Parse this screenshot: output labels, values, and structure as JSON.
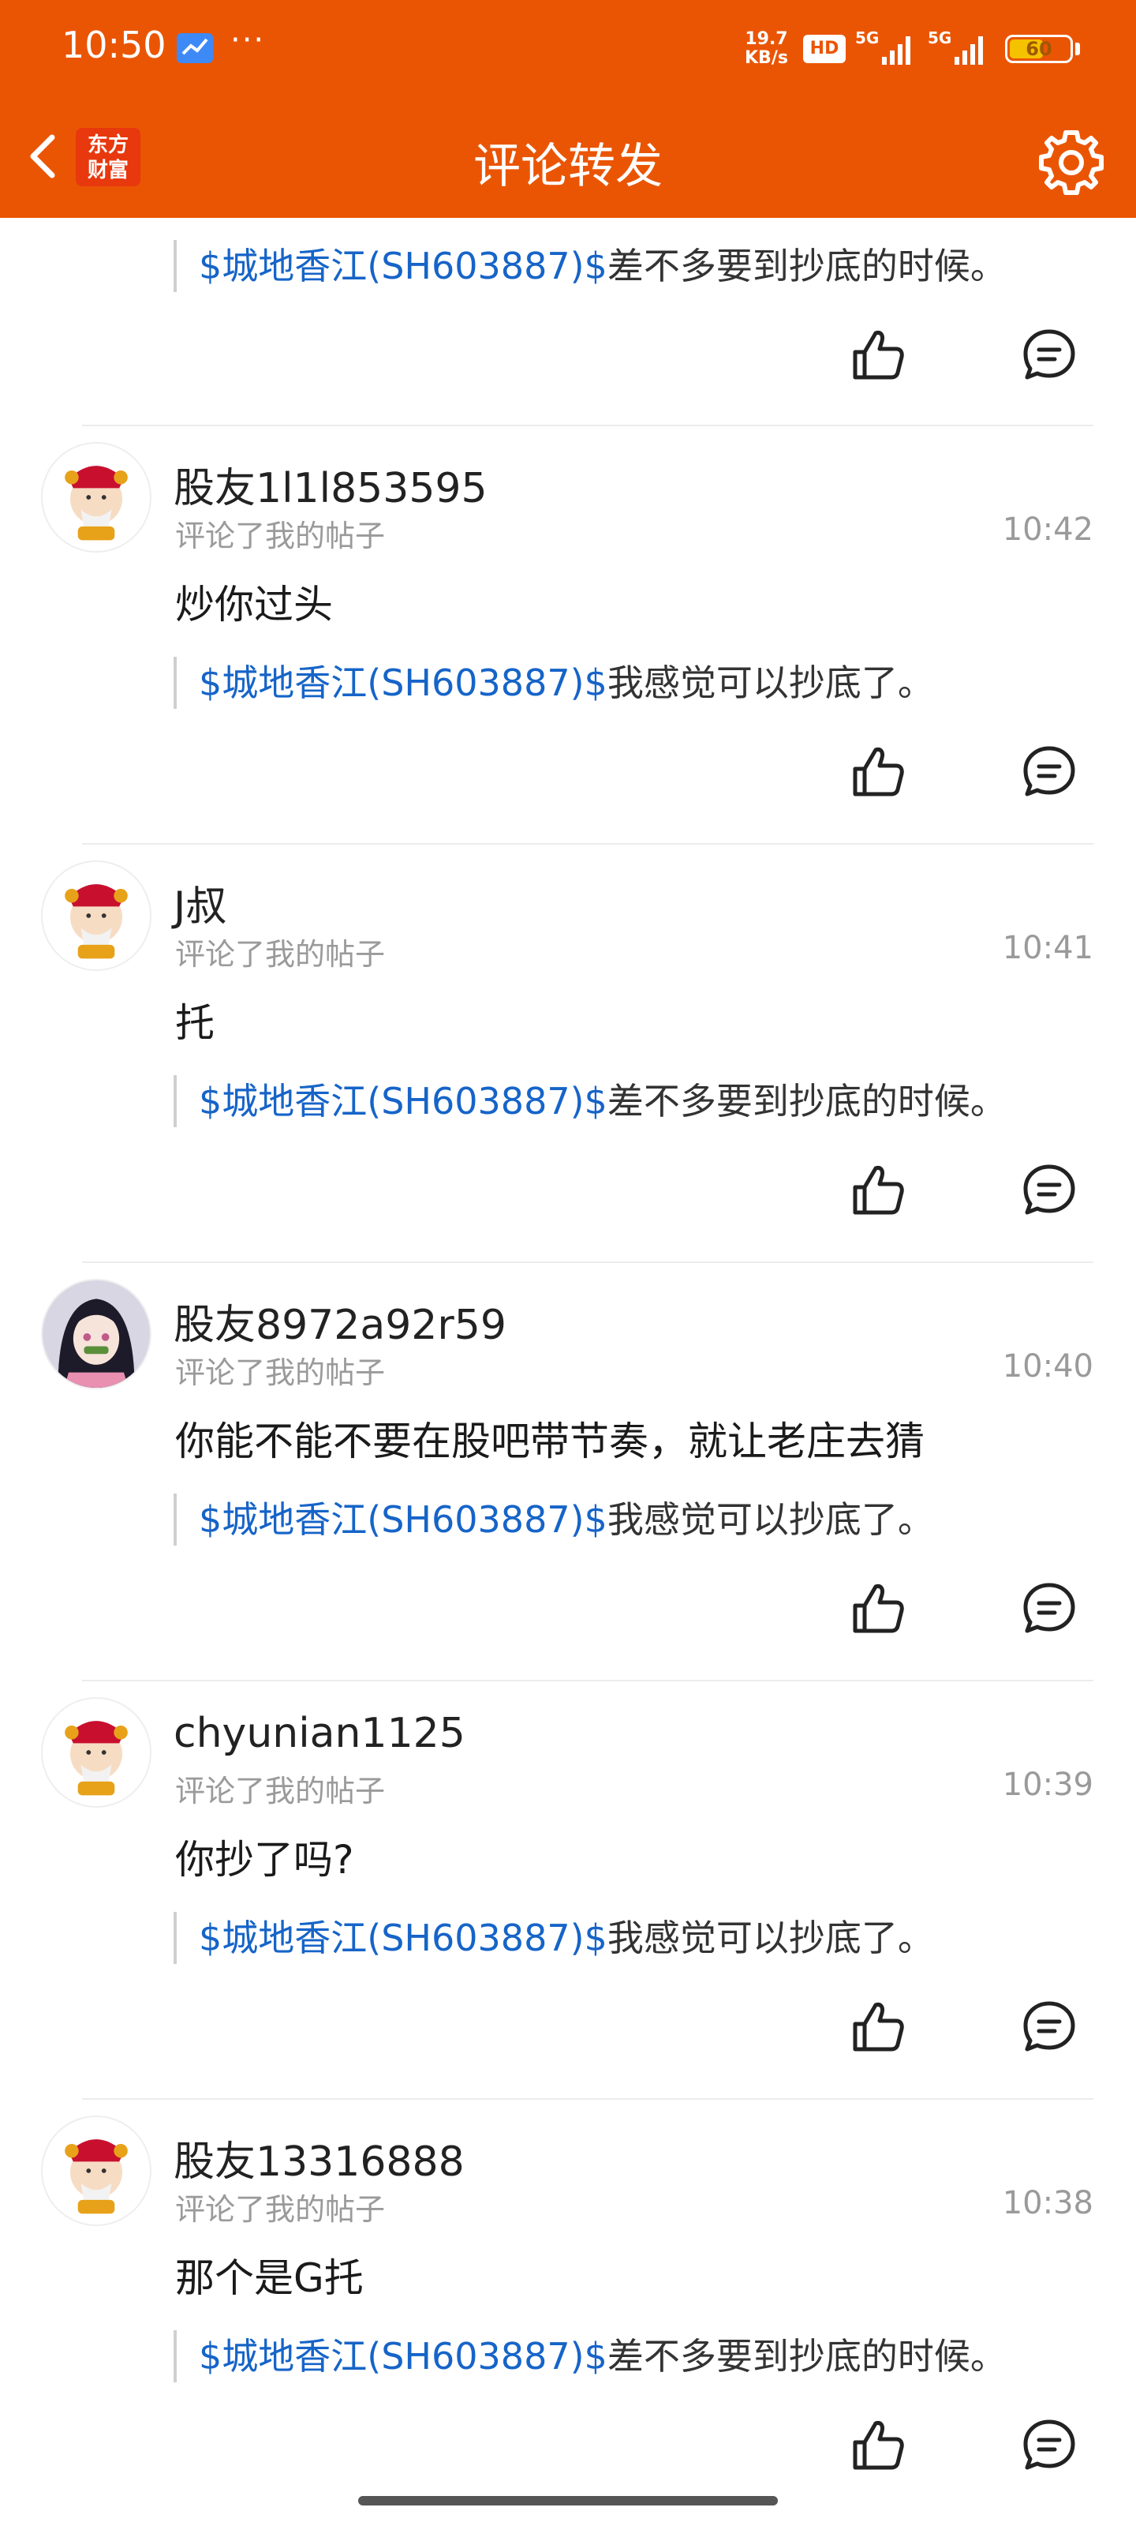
{
  "status_bar": {
    "time": "10:50",
    "more_dots": "···",
    "net_speed_value": "19.7",
    "net_speed_unit": "KB/s",
    "hd_badge": "HD",
    "signal_1_label": "5G",
    "signal_2_label": "5G",
    "battery": "60",
    "battery_level": 0.6
  },
  "header": {
    "title": "评论转发",
    "logo_line1": "东方",
    "logo_line2": "财富",
    "accent_color": "#ea5504"
  },
  "comments": [
    {
      "quote_prefix": "$城地香江(SH603887)$",
      "quote_text": "差不多要到抄底的时候。"
    },
    {
      "username": "股友1l1l853595",
      "action": "评论了我的帖子",
      "time": "10:42",
      "text": "炒你过头",
      "quote_prefix": "$城地香江(SH603887)$",
      "quote_text": "我感觉可以抄底了。"
    },
    {
      "username": "J叔",
      "action": "评论了我的帖子",
      "time": "10:41",
      "text": "托",
      "quote_prefix": "$城地香江(SH603887)$",
      "quote_text": "差不多要到抄底的时候。"
    },
    {
      "username": "股友8972a92r59",
      "action": "评论了我的帖子",
      "time": "10:40",
      "text": "你能不能不要在股吧带节奏，就让老庄去猜",
      "quote_prefix": "$城地香江(SH603887)$",
      "quote_text": "我感觉可以抄底了。"
    },
    {
      "username": "chyunian1125",
      "action": "评论了我的帖子",
      "time": "10:39",
      "text": "你抄了吗?",
      "quote_prefix": "$城地香江(SH603887)$",
      "quote_text": "我感觉可以抄底了。"
    },
    {
      "username": "股友13316888",
      "action": "评论了我的帖子",
      "time": "10:38",
      "text": "那个是G托",
      "quote_prefix": "$城地香江(SH603887)$",
      "quote_text": "差不多要到抄底的时候。"
    }
  ],
  "icons": {
    "like": "thumbs-up-icon",
    "reply": "comment-bubble-icon",
    "back": "back-arrow-icon",
    "settings": "gear-icon"
  },
  "colors": {
    "link": "#1664c8",
    "muted": "#9a9a9a"
  }
}
